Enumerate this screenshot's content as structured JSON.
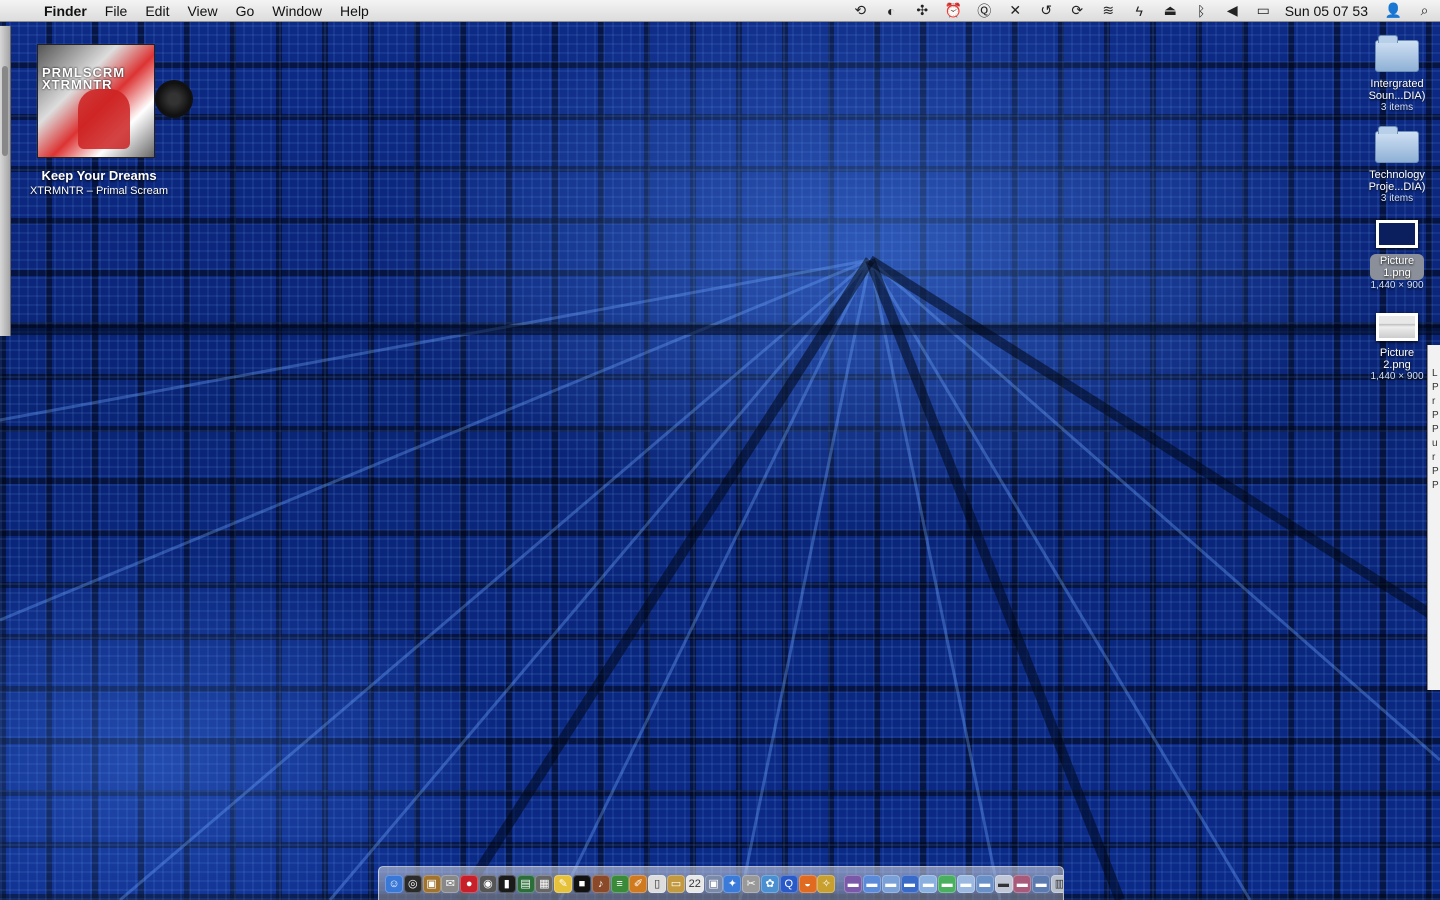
{
  "menubar": {
    "apple_glyph": "",
    "app_name": "Finder",
    "menus": [
      "File",
      "Edit",
      "View",
      "Go",
      "Window",
      "Help"
    ],
    "status_icons": [
      {
        "name": "script-icon",
        "glyph": "⟲"
      },
      {
        "name": "moon-icon",
        "glyph": "◐"
      },
      {
        "name": "paw-icon",
        "glyph": "✣"
      },
      {
        "name": "alarm-icon",
        "glyph": "⏰"
      },
      {
        "name": "q-icon",
        "glyph": "Ⓠ"
      },
      {
        "name": "tools-icon",
        "glyph": "✕"
      },
      {
        "name": "time-machine-icon",
        "glyph": "↺"
      },
      {
        "name": "sync-icon",
        "glyph": "⟳"
      },
      {
        "name": "wifi-icon",
        "glyph": "≋"
      },
      {
        "name": "bolt-icon",
        "glyph": "ϟ"
      },
      {
        "name": "eject-icon",
        "glyph": "⏏"
      },
      {
        "name": "bluetooth-icon",
        "glyph": "ᛒ"
      },
      {
        "name": "volume-icon",
        "glyph": "◀"
      },
      {
        "name": "battery-icon",
        "glyph": "▭"
      }
    ],
    "clock": "Sun 05 07 53",
    "user_glyph": "👤",
    "search_glyph": "⌕"
  },
  "now_playing": {
    "album_text": "PRMLSCRM\nXTRMNTR",
    "title": "Keep Your Dreams",
    "artist": "XTRMNTR – Primal Scream"
  },
  "desktop_icons": [
    {
      "label": "Intergrated Soun...DIA)",
      "sub": "3 items",
      "type": "folder"
    },
    {
      "label": "Technology Proje...DIA)",
      "sub": "3 items",
      "type": "folder"
    },
    {
      "label": "Picture 1.png",
      "sub": "1,440 × 900",
      "type": "image-dark"
    },
    {
      "label": "Picture 2.png",
      "sub": "1,440 × 900",
      "type": "image-light"
    }
  ],
  "right_panel_text": "L\nP\nr\nP\nP\nu\nr\nP\nP",
  "dock": {
    "apps": [
      {
        "name": "finder-icon",
        "color": "#3a78d8",
        "glyph": "☺"
      },
      {
        "name": "dashboard-icon",
        "color": "#2a2a2a",
        "glyph": "◎"
      },
      {
        "name": "package-icon",
        "color": "#a0742e",
        "glyph": "▣"
      },
      {
        "name": "mail-stamp-icon",
        "color": "#888",
        "glyph": "✉"
      },
      {
        "name": "red-app-icon",
        "color": "#c8202a",
        "glyph": "●"
      },
      {
        "name": "gauge-icon",
        "color": "#555",
        "glyph": "◉"
      },
      {
        "name": "terminal-icon",
        "color": "#1a1a1a",
        "glyph": "▮"
      },
      {
        "name": "screen-icon",
        "color": "#2c6e3a",
        "glyph": "▤"
      },
      {
        "name": "grid-app-icon",
        "color": "#666",
        "glyph": "▦"
      },
      {
        "name": "notes-icon",
        "color": "#e6c13a",
        "glyph": "✎"
      },
      {
        "name": "black-app-icon",
        "color": "#111",
        "glyph": "■"
      },
      {
        "name": "guitar-icon",
        "color": "#8a4a2a",
        "glyph": "♪"
      },
      {
        "name": "green-app-icon",
        "color": "#3a8a3a",
        "glyph": "≡"
      },
      {
        "name": "pencil-icon",
        "color": "#d07a20",
        "glyph": "✐"
      },
      {
        "name": "document-icon",
        "color": "#ddd",
        "glyph": "▯"
      },
      {
        "name": "folder-app-icon",
        "color": "#c49a40",
        "glyph": "▭"
      },
      {
        "name": "calendar-icon",
        "color": "#e8e8e8",
        "glyph": "22"
      },
      {
        "name": "preview-icon",
        "color": "#7a8aa8",
        "glyph": "▣"
      },
      {
        "name": "safari-icon",
        "color": "#3a7ad8",
        "glyph": "✦"
      },
      {
        "name": "tools-app-icon",
        "color": "#999",
        "glyph": "✂"
      },
      {
        "name": "photos-icon",
        "color": "#4a90d0",
        "glyph": "✿"
      },
      {
        "name": "search-app-icon",
        "color": "#2a5ac8",
        "glyph": "Q"
      },
      {
        "name": "firefox-icon",
        "color": "#e06a20",
        "glyph": "◒"
      },
      {
        "name": "compass-icon",
        "color": "#c8a030",
        "glyph": "✧"
      }
    ],
    "stacks": [
      {
        "name": "stack-icon-1",
        "color": "#7a5aa8",
        "glyph": "▬"
      },
      {
        "name": "stack-icon-2",
        "color": "#5a8ad8",
        "glyph": "▬"
      },
      {
        "name": "stack-icon-3",
        "color": "#7aa0d8",
        "glyph": "▬"
      },
      {
        "name": "stack-icon-4",
        "color": "#3a6ac8",
        "glyph": "▬"
      },
      {
        "name": "stack-icon-5",
        "color": "#8ab0e0",
        "glyph": "▬"
      },
      {
        "name": "stack-icon-6",
        "color": "#4ab060",
        "glyph": "▬"
      },
      {
        "name": "stack-icon-7",
        "color": "#9ab8e0",
        "glyph": "▬"
      },
      {
        "name": "stack-icon-8",
        "color": "#6a90c8",
        "glyph": "▬"
      },
      {
        "name": "stack-icon-9",
        "color": "#c0c8d8",
        "glyph": "▬"
      },
      {
        "name": "stack-icon-10",
        "color": "#a85a7a",
        "glyph": "▬"
      },
      {
        "name": "stack-icon-11",
        "color": "#5a7ab0",
        "glyph": "▬"
      },
      {
        "name": "trash-icon",
        "color": "#b8c0cc",
        "glyph": "▥"
      }
    ]
  }
}
